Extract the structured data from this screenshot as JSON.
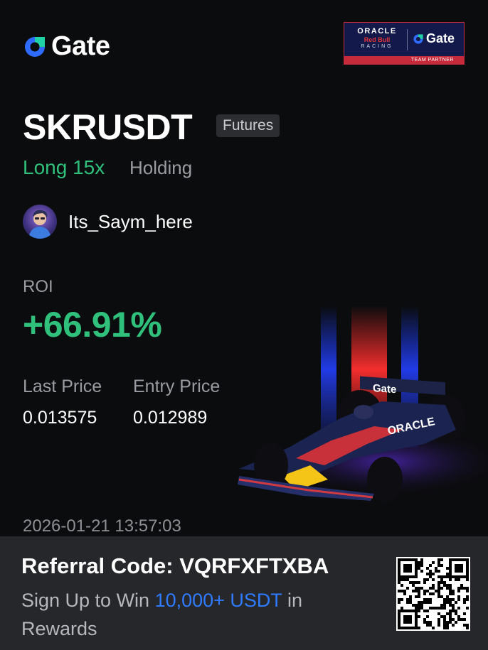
{
  "brand": {
    "name": "Gate",
    "logo_icon": "gate-logo-icon"
  },
  "partner_badge": {
    "oracle": "ORACLE",
    "red_bull": "Red Bull",
    "racing": "RACING",
    "gate": "Gate",
    "caption": "TEAM PARTNER"
  },
  "trade": {
    "pair": "SKRUSDT",
    "market_type": "Futures",
    "position": "Long 15x",
    "status": "Holding"
  },
  "user": {
    "username": "Its_Saym_here",
    "avatar_icon": "user-avatar"
  },
  "roi": {
    "label": "ROI",
    "value": "+66.91%"
  },
  "prices": {
    "last_price_label": "Last Price",
    "last_price": "0.013575",
    "entry_price_label": "Entry Price",
    "entry_price": "0.012989"
  },
  "timestamp": "2026-01-21 13:57:03",
  "footer": {
    "referral": "Referral Code: VQRFXFTXBA",
    "promo_prefix": "Sign Up to Win ",
    "promo_highlight": "10,000+ USDT",
    "promo_suffix": " in Rewards",
    "qr_icon": "qr-code"
  },
  "colors": {
    "background": "#0b0c0e",
    "positive": "#2fc17c",
    "muted": "#9a9ca1",
    "link": "#2f7bff",
    "footer_bg": "#26272b",
    "badge_bg": "#13194a",
    "badge_accent": "#c52b3a"
  }
}
